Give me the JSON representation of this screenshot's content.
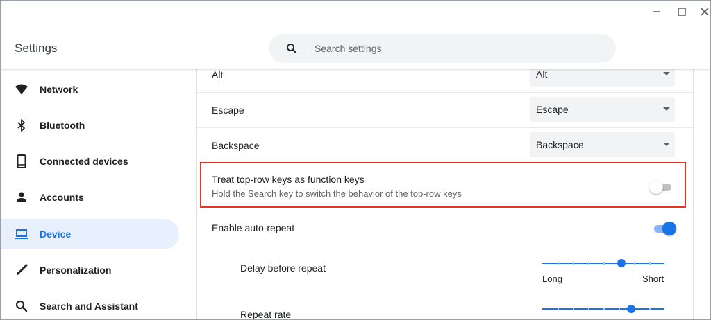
{
  "app": {
    "title": "Settings"
  },
  "search": {
    "placeholder": "Search settings"
  },
  "sidebar": {
    "items": [
      {
        "label": "Network",
        "icon": "wifi-icon",
        "active": false
      },
      {
        "label": "Bluetooth",
        "icon": "bluetooth-icon",
        "active": false
      },
      {
        "label": "Connected devices",
        "icon": "phone-icon",
        "active": false
      },
      {
        "label": "Accounts",
        "icon": "person-icon",
        "active": false
      },
      {
        "label": "Device",
        "icon": "laptop-icon",
        "active": true
      },
      {
        "label": "Personalization",
        "icon": "brush-icon",
        "active": false
      },
      {
        "label": "Search and Assistant",
        "icon": "search-icon",
        "active": false
      }
    ]
  },
  "keyboard": {
    "remaps": [
      {
        "label": "Alt",
        "value": "Alt"
      },
      {
        "label": "Escape",
        "value": "Escape"
      },
      {
        "label": "Backspace",
        "value": "Backspace"
      }
    ],
    "top_row": {
      "label": "Treat top-row keys as function keys",
      "sublabel": "Hold the Search key to switch the behavior of the top-row keys",
      "enabled": false
    },
    "auto_repeat": {
      "label": "Enable auto-repeat",
      "enabled": true
    },
    "delay": {
      "label": "Delay before repeat",
      "min_label": "Long",
      "max_label": "Short",
      "value": 0.67
    },
    "rate": {
      "label": "Repeat rate",
      "value": 0.74
    }
  },
  "colors": {
    "accent": "#1a73e8",
    "highlight": "#e8341c",
    "active_bg": "#e8f0fe"
  }
}
